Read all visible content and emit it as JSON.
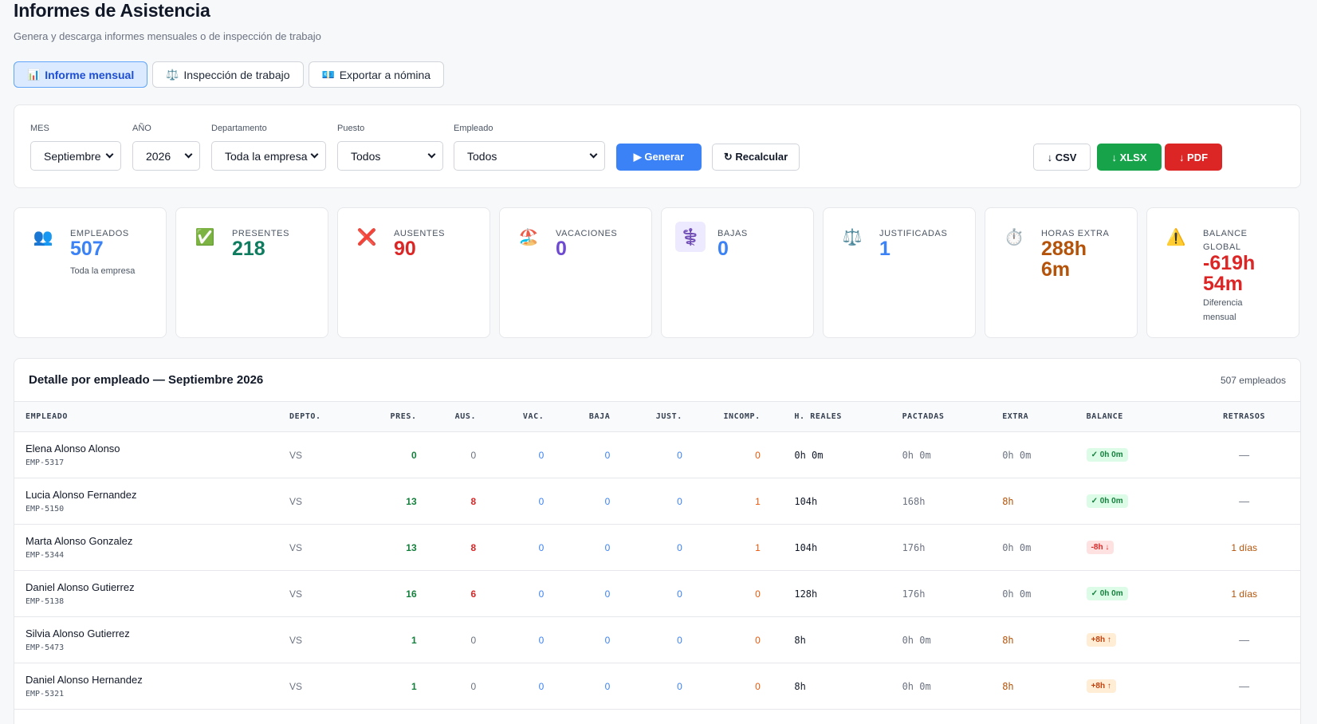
{
  "header": {
    "title": "Informes de Asistencia",
    "subtitle": "Genera y descarga informes mensuales o de inspección de trabajo"
  },
  "tabs": [
    {
      "icon": "📊",
      "label": "Informe mensual"
    },
    {
      "icon": "⚖️",
      "label": "Inspección de trabajo"
    },
    {
      "icon": "💶",
      "label": "Exportar a nómina"
    }
  ],
  "filters": {
    "month": {
      "label": "MES",
      "value": "Septiembre"
    },
    "year": {
      "label": "AÑO",
      "value": "2026"
    },
    "department": {
      "label": "Departamento",
      "value": "Toda la empresa"
    },
    "position": {
      "label": "Puesto",
      "value": "Todos"
    },
    "employee": {
      "label": "Empleado",
      "value": "Todos"
    },
    "generate_label": "▶ Generar",
    "recalc_label": "↻ Recalcular",
    "csv_label": "↓ CSV",
    "xlsx_label": "↓ XLSX",
    "pdf_label": "↓ PDF"
  },
  "stats": [
    {
      "icon": "👥",
      "label": "EMPLEADOS",
      "value": "507",
      "sub": "Toda la empresa",
      "color": "#3b82f6"
    },
    {
      "icon": "✅",
      "label": "PRESENTES",
      "value": "218",
      "sub": "",
      "color": "#0f7b5f"
    },
    {
      "icon": "❌",
      "label": "AUSENTES",
      "value": "90",
      "sub": "",
      "color": "#dc2626"
    },
    {
      "icon": "🏖️",
      "label": "VACACIONES",
      "value": "0",
      "sub": "",
      "color": "#6d4ad0"
    },
    {
      "icon": "⚕️",
      "label": "BAJAS",
      "value": "0",
      "sub": "",
      "color": "#3b82f6"
    },
    {
      "icon": "⚖️",
      "label": "JUSTIFICADAS",
      "value": "1",
      "sub": "",
      "color": "#3b82f6"
    },
    {
      "icon": "⏱️",
      "label": "HORAS EXTRA",
      "value": "288h 6m",
      "sub": "",
      "color": "#b45309"
    },
    {
      "icon": "⚠️",
      "label": "BALANCE GLOBAL",
      "value": "-619h 54m",
      "sub": "Diferencia mensual",
      "color": "#dc2626"
    }
  ],
  "detail": {
    "title": "Detalle por empleado — Septiembre 2026",
    "count": "507 empleados",
    "columns": [
      "EMPLEADO",
      "DEPTO.",
      "PRES.",
      "AUS.",
      "VAC.",
      "BAJA",
      "JUST.",
      "INCOMP.",
      "H. REALES",
      "PACTADAS",
      "EXTRA",
      "BALANCE",
      "RETRASOS"
    ],
    "rows": [
      {
        "name": "Elena Alonso Alonso",
        "id": "EMP-5317",
        "dept": "VS",
        "pres": "0",
        "aus": "0",
        "vac": "0",
        "baja": "0",
        "just": "0",
        "incomp": "0",
        "reales": "0h 0m",
        "pactadas": "0h 0m",
        "extra": "0h 0m",
        "balance": "✓ 0h 0m",
        "balance_type": "ok",
        "retrasos": "—"
      },
      {
        "name": "Lucia Alonso Fernandez",
        "id": "EMP-5150",
        "dept": "VS",
        "pres": "13",
        "aus": "8",
        "vac": "0",
        "baja": "0",
        "just": "0",
        "incomp": "1",
        "reales": "104h",
        "pactadas": "168h",
        "extra": "8h",
        "balance": "✓ 0h 0m",
        "balance_type": "ok",
        "retrasos": "—"
      },
      {
        "name": "Marta Alonso Gonzalez",
        "id": "EMP-5344",
        "dept": "VS",
        "pres": "13",
        "aus": "8",
        "vac": "0",
        "baja": "0",
        "just": "0",
        "incomp": "1",
        "reales": "104h",
        "pactadas": "176h",
        "extra": "0h 0m",
        "balance": "-8h ↓",
        "balance_type": "neg",
        "retrasos": "1 días"
      },
      {
        "name": "Daniel Alonso Gutierrez",
        "id": "EMP-5138",
        "dept": "VS",
        "pres": "16",
        "aus": "6",
        "vac": "0",
        "baja": "0",
        "just": "0",
        "incomp": "0",
        "reales": "128h",
        "pactadas": "176h",
        "extra": "0h 0m",
        "balance": "✓ 0h 0m",
        "balance_type": "ok",
        "retrasos": "1 días"
      },
      {
        "name": "Silvia Alonso Gutierrez",
        "id": "EMP-5473",
        "dept": "VS",
        "pres": "1",
        "aus": "0",
        "vac": "0",
        "baja": "0",
        "just": "0",
        "incomp": "0",
        "reales": "8h",
        "pactadas": "0h 0m",
        "extra": "8h",
        "balance": "+8h ↑",
        "balance_type": "pos",
        "retrasos": "—"
      },
      {
        "name": "Daniel Alonso Hernandez",
        "id": "EMP-5321",
        "dept": "VS",
        "pres": "1",
        "aus": "0",
        "vac": "0",
        "baja": "0",
        "just": "0",
        "incomp": "0",
        "reales": "8h",
        "pactadas": "0h 0m",
        "extra": "8h",
        "balance": "+8h ↑",
        "balance_type": "pos",
        "retrasos": "—"
      }
    ]
  }
}
